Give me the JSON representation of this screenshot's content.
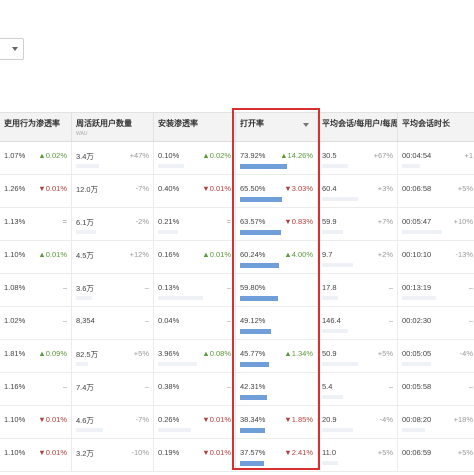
{
  "colors": {
    "bar": "#6f9ed8",
    "up": "#5a9a3c",
    "down": "#b0403c",
    "highlight": "#d83030"
  },
  "icons": {
    "dropdown": "chevron-down-icon",
    "sort": "sort-desc-icon"
  },
  "headers": [
    {
      "label": "吏用行为渗透率",
      "sub": ""
    },
    {
      "label": "周活跃用户数量",
      "sub": "WAU"
    },
    {
      "label": "安装渗透率",
      "sub": ""
    },
    {
      "label": "打开率",
      "sub": ""
    },
    {
      "label": "平均会话/每用户/每周",
      "sub": ""
    },
    {
      "label": "平均会话时长",
      "sub": ""
    }
  ],
  "rows": [
    [
      "1.07%",
      "▲0.02%",
      "3.4万",
      "+47%",
      "0.10%",
      "▲0.02%",
      "73.92%",
      "▲14.26%",
      "30.5",
      "+67%",
      "00:04:54",
      "+1"
    ],
    [
      "1.26%",
      "▼0.01%",
      "12.0万",
      "-7%",
      "0.40%",
      "▼0.01%",
      "65.50%",
      "▼3.03%",
      "60.4",
      "+3%",
      "00:06:58",
      "+5%"
    ],
    [
      "1.13%",
      "=",
      "6.1万",
      "-2%",
      "0.21%",
      "=",
      "63.57%",
      "▼0.83%",
      "59.9",
      "+7%",
      "00:05:47",
      "+10%"
    ],
    [
      "1.10%",
      "▲0.01%",
      "4.5万",
      "+12%",
      "0.16%",
      "▲0.01%",
      "60.24%",
      "▲4.00%",
      "9.7",
      "+2%",
      "00:10:10",
      "-13%"
    ],
    [
      "1.08%",
      "–",
      "3.6万",
      "–",
      "0.13%",
      "–",
      "59.80%",
      "",
      "17.8",
      "–",
      "00:13:19",
      "–"
    ],
    [
      "1.02%",
      "–",
      "8,354",
      "–",
      "0.04%",
      "–",
      "49.12%",
      "",
      "146.4",
      "–",
      "00:02:30",
      "–"
    ],
    [
      "1.81%",
      "▲0.09%",
      "82.5万",
      "+5%",
      "3.96%",
      "▲0.08%",
      "45.77%",
      "▲1.34%",
      "50.9",
      "+5%",
      "00:05:05",
      "-4%"
    ],
    [
      "1.16%",
      "–",
      "7.4万",
      "–",
      "0.38%",
      "–",
      "42.31%",
      "",
      "5.4",
      "–",
      "00:05:58",
      "–"
    ],
    [
      "1.10%",
      "▼0.01%",
      "4.6万",
      "-7%",
      "0.26%",
      "▼0.01%",
      "38.34%",
      "▼1.85%",
      "20.9",
      "-4%",
      "00:08:20",
      "+18%"
    ],
    [
      "1.10%",
      "▼0.01%",
      "3.2万",
      "-10%",
      "0.19%",
      "▼0.01%",
      "37.57%",
      "▼2.41%",
      "11.0",
      "+5%",
      "00:06:59",
      "+5%"
    ]
  ]
}
